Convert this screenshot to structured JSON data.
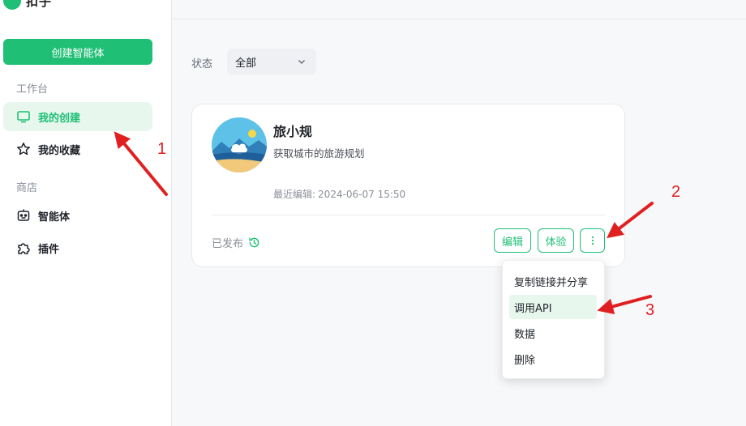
{
  "app": {
    "logo_text": "扣子"
  },
  "sidebar": {
    "create_label": "创建智能体",
    "workbench_label": "工作台",
    "workbench_items": [
      {
        "label": "我的创建",
        "icon": "monitor-icon",
        "active": true
      },
      {
        "label": "我的收藏",
        "icon": "star-icon",
        "active": false
      }
    ],
    "store_label": "商店",
    "store_items": [
      {
        "label": "智能体",
        "icon": "robot-icon"
      },
      {
        "label": "插件",
        "icon": "puzzle-icon"
      }
    ]
  },
  "filter": {
    "label": "状态",
    "selected": "全部"
  },
  "card": {
    "name": "旅小规",
    "description": "获取城市的旅游规划",
    "edit_time_label": "最近编辑:",
    "edit_time": "2024-06-07 15:50",
    "publish_status": "已发布",
    "edit_button": "编辑",
    "try_button": "体验"
  },
  "more_menu": {
    "items": [
      "复制链接并分享",
      "调用API",
      "数据",
      "删除"
    ],
    "highlighted": "调用API"
  },
  "annotations": {
    "step1": "1",
    "step2": "2",
    "step3": "3",
    "color": "#e02020"
  },
  "colors": {
    "accent": "#1fbf75",
    "accent_light": "#e7f7ee"
  }
}
